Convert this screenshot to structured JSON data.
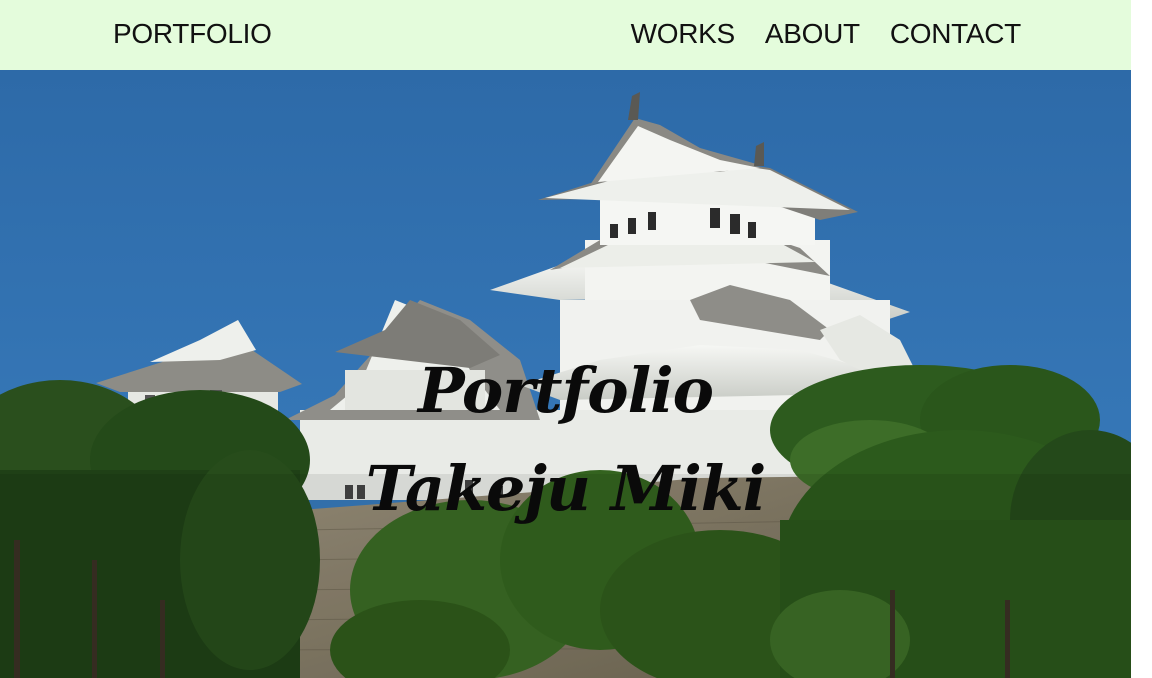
{
  "header": {
    "brand": "PORTFOLIO",
    "nav": [
      "WORKS",
      "ABOUT",
      "CONTACT"
    ],
    "background": "#e4fcdc"
  },
  "hero": {
    "title_line1": "Portfolio",
    "title_line2": "Takeju Miki",
    "sky_color": "#2a6bae",
    "foliage_color": "#2c5a1e",
    "castle_color": "#eef0ec"
  }
}
